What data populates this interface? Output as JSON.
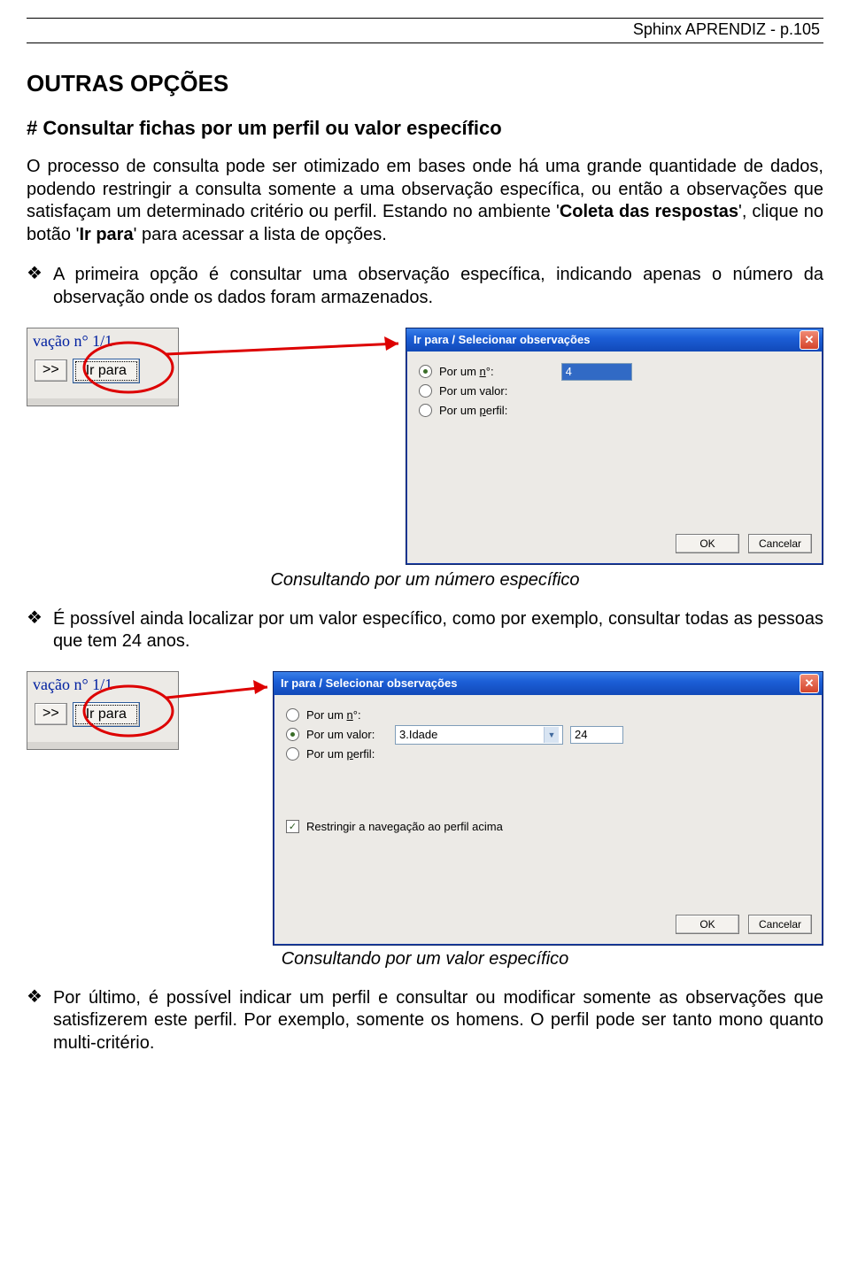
{
  "header": "Sphinx APRENDIZ - p.105",
  "h1": "OUTRAS OPÇÕES",
  "h2": "# Consultar fichas por um perfil ou valor específico",
  "intro_pre": "O processo de consulta pode ser otimizado em bases onde há uma grande quantidade de dados, podendo restringir a consulta somente a uma observação específica, ou então a observações que satisfaçam um determinado critério ou perfil. Estando no ambiente '",
  "intro_bold1": "Coleta das respostas",
  "intro_mid": "', clique no botão '",
  "intro_bold2": "Ir para",
  "intro_post": "' para acessar a lista de opções.",
  "bullet1": "A primeira opção é consultar uma observação específica, indicando apenas o número da observação onde os dados foram armazenados.",
  "caption1": "Consultando por um número específico",
  "bullet2": "É possível ainda localizar por um valor específico, como por exemplo, consultar todas as pessoas que tem 24 anos.",
  "caption2": "Consultando por um valor específico",
  "bullet3": "Por último, é possível indicar um perfil e consultar ou modificar somente as observações que satisfizerem este perfil. Por exemplo, somente os homens. O perfil pode ser tanto mono quanto multi-critério.",
  "bullet_mark": "❖",
  "snippet": {
    "title": "vação n° 1/1",
    "nav": ">>",
    "go": "Ir para"
  },
  "dialog": {
    "title": "Ir para / Selecionar observações",
    "close": "✕",
    "radio_num_pre": "Por um ",
    "radio_num_u": "n",
    "radio_num_post": "°:",
    "radio_val": "Por um valor:",
    "radio_perfil_pre": "Por um ",
    "radio_perfil_u": "p",
    "radio_perfil_post": "erfil:",
    "num_value": "4",
    "sel_field": "3.Idade",
    "val_value": "24",
    "restrict": "Restringir a navegação ao perfil acima",
    "ok": "OK",
    "cancel": "Cancelar"
  }
}
